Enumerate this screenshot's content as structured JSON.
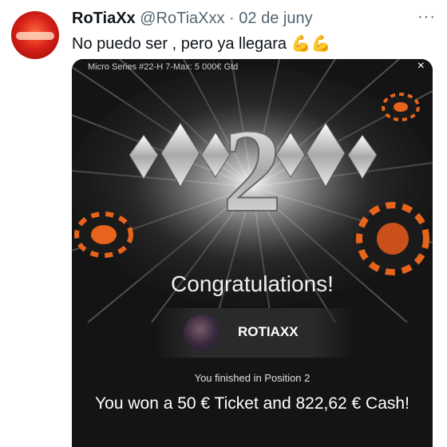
{
  "tweet": {
    "author_name": "RoTiaXx",
    "author_handle": "@RoTiaXxx",
    "separator": "·",
    "date": "02 de juny",
    "more_icon": "more-dots-icon",
    "text": "No puedo ser , pero ya llegara",
    "emojis": "💪💪"
  },
  "card": {
    "window_title": "Micro Series #22-H 7-Max: 5 000€ Gtd",
    "close_label": "×",
    "position_number": "2",
    "heading": "Congratulations!",
    "player_name": "ROTIAXX",
    "finished_text": "You finished in Position 2",
    "won_text": "You won a 50 € Ticket and 822,62 € Cash!"
  },
  "colors": {
    "card_background": "#141414",
    "chip_orange": "#e8641c",
    "avatar_red": "#d8231a"
  }
}
